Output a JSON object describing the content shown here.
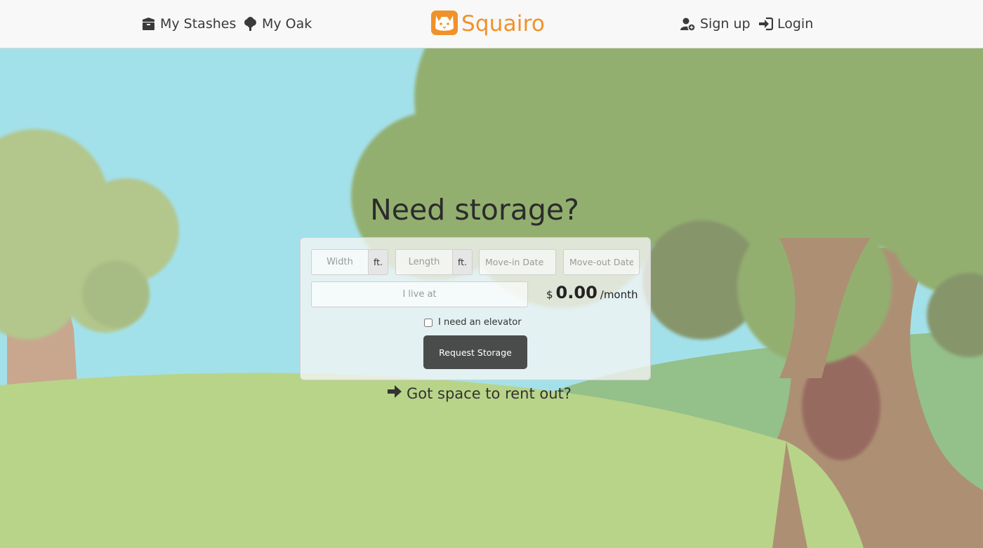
{
  "nav": {
    "left": [
      {
        "label": "My Stashes",
        "icon": "box-icon"
      },
      {
        "label": "My Oak",
        "icon": "tree-icon"
      }
    ],
    "brand": {
      "name": "Squairo",
      "logo": "squirrel-icon",
      "color": "#f0922a"
    },
    "right": [
      {
        "label": "Sign up",
        "icon": "user-plus-icon"
      },
      {
        "label": "Login",
        "icon": "sign-in-icon"
      }
    ]
  },
  "hero": {
    "title": "Need storage?"
  },
  "form": {
    "width_placeholder": "Width",
    "length_placeholder": "Length",
    "unit": "ft.",
    "movein_placeholder": "Move-in Date",
    "moveout_placeholder": "Move-out Date",
    "address_placeholder": "I live at",
    "price": {
      "currency": "$",
      "amount": "0.00",
      "period": "/month"
    },
    "elevator_label": "I need an elevator",
    "elevator_checked": false,
    "submit_label": "Request Storage"
  },
  "rent_link": {
    "label": "Got space to rent out?",
    "icon": "arrow-right-icon"
  },
  "colors": {
    "sky": "#a3e1ea",
    "foliage": "#93af70",
    "trunk": "#ad9074",
    "grass": "#b8d489",
    "brand_orange": "#f0922a",
    "button": "#4a4c4c"
  }
}
